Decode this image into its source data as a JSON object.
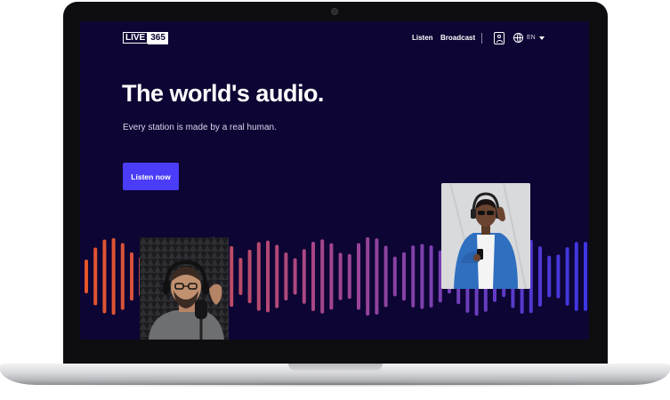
{
  "header": {
    "logo_live": "LIVE",
    "logo_num": "365",
    "nav": [
      "Listen",
      "Broadcast"
    ],
    "lang": "EN",
    "icons": [
      "user-icon",
      "globe-icon",
      "chevron-down-icon"
    ]
  },
  "hero": {
    "title": "The world's audio.",
    "subtitle": "Every station is made by a real human.",
    "cta": "Listen now"
  },
  "colors": {
    "background": "#0d0533",
    "accent": "#4a3cf7",
    "wave_start": "#e2552b",
    "wave_mid": "#a2458f",
    "wave_end": "#3d36e3"
  }
}
